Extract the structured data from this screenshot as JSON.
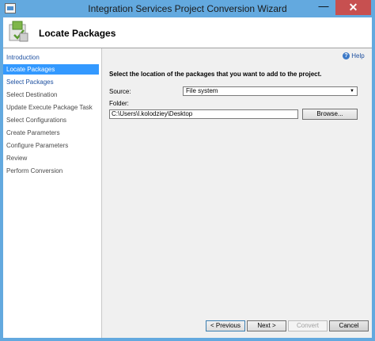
{
  "window": {
    "title": "Integration Services Project Conversion Wizard",
    "minimize_label": "—",
    "close_label": "✕"
  },
  "header": {
    "title": "Locate Packages"
  },
  "nav": {
    "items": [
      {
        "label": "Introduction"
      },
      {
        "label": "Locate Packages"
      },
      {
        "label": "Select Packages"
      },
      {
        "label": "Select Destination"
      },
      {
        "label": "Update Execute Package Task"
      },
      {
        "label": "Select Configurations"
      },
      {
        "label": "Create Parameters"
      },
      {
        "label": "Configure Parameters"
      },
      {
        "label": "Review"
      },
      {
        "label": "Perform Conversion"
      }
    ],
    "selected": "Locate Packages"
  },
  "help": {
    "label": "Help",
    "icon": "?"
  },
  "main": {
    "instruction": "Select the location of the packages that you want to add to the project.",
    "source_label": "Source:",
    "source_value": "File system",
    "folder_label": "Folder:",
    "folder_value": "C:\\Users\\l.kolodziey\\Desktop",
    "browse_label": "Browse..."
  },
  "footer": {
    "previous_label": "< Previous",
    "next_label": "Next >",
    "convert_label": "Convert",
    "cancel_label": "Cancel"
  },
  "colors": {
    "title_bar": "#63a9df",
    "selection": "#3399ff",
    "close_button": "#c75050",
    "link": "#1e50a0"
  }
}
